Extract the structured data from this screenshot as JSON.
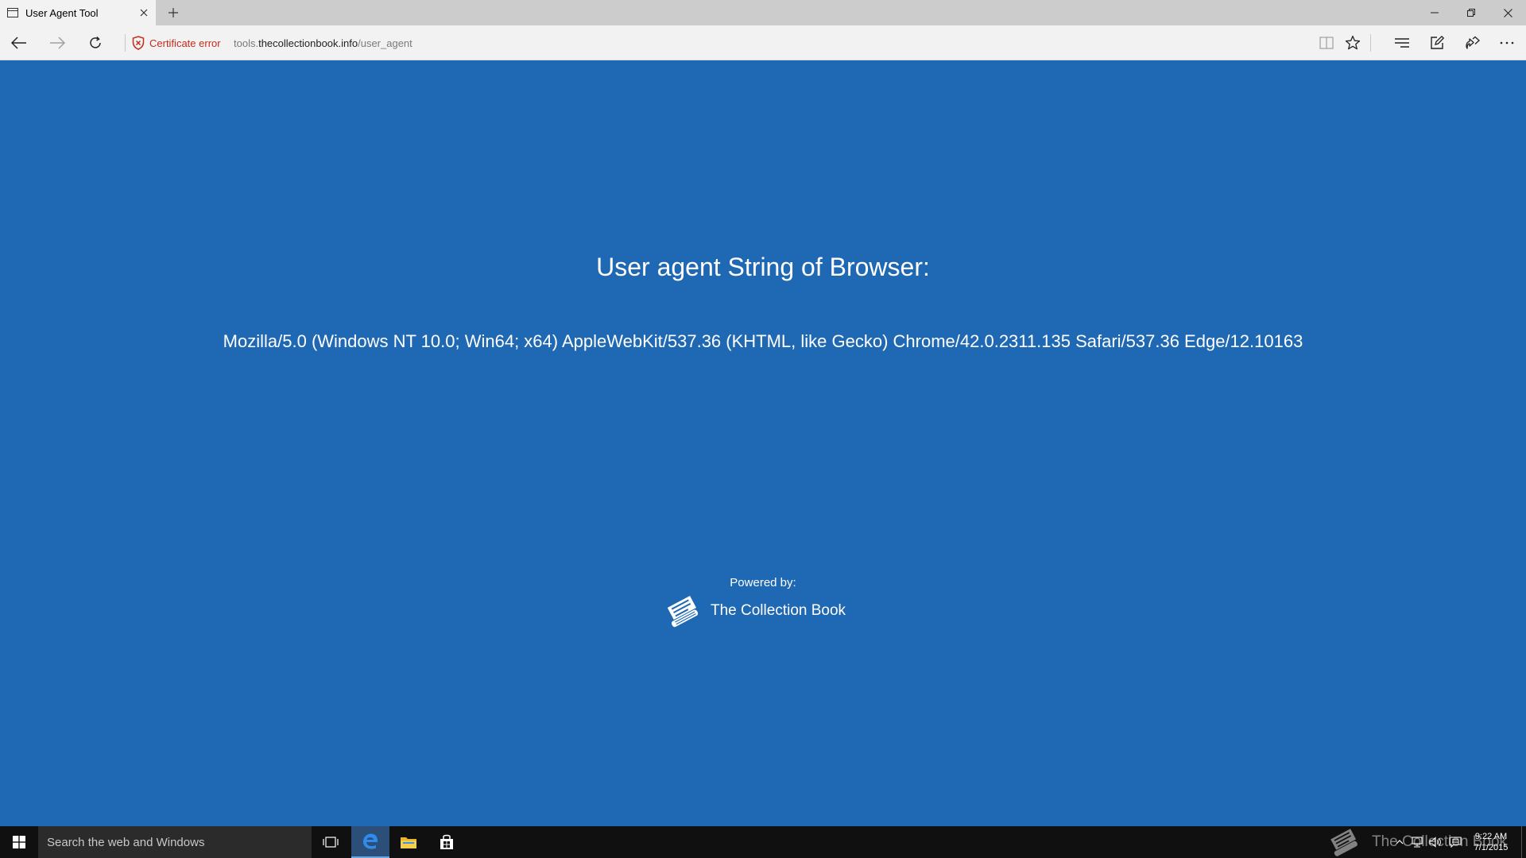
{
  "tab": {
    "title": "User Agent Tool"
  },
  "address_bar": {
    "security_label": "Certificate error",
    "url_prefix": "tools.",
    "url_host": "thecollectionbook.info",
    "url_path": "/user_agent"
  },
  "page": {
    "heading": "User agent String of Browser:",
    "user_agent": "Mozilla/5.0 (Windows NT 10.0; Win64; x64) AppleWebKit/537.36 (KHTML, like Gecko) Chrome/42.0.2311.135 Safari/537.36 Edge/12.10163",
    "powered_by_label": "Powered by:",
    "brand_name": "The Collection Book"
  },
  "taskbar": {
    "search_placeholder": "Search the web and Windows",
    "watermark_text": "The Collection Book",
    "time": "9:22 AM",
    "date": "7/1/2015"
  },
  "colors": {
    "page_background": "#1f68b4",
    "certificate_error": "#c42b1c",
    "taskbar": "#101010"
  },
  "icons": [
    "page-icon",
    "close-icon",
    "plus-icon",
    "minimize-icon",
    "restore-icon",
    "back-icon",
    "forward-icon",
    "refresh-icon",
    "shield-icon",
    "reading-view-icon",
    "star-icon",
    "hub-icon",
    "web-note-icon",
    "share-icon",
    "more-icon",
    "book-icon",
    "windows-icon",
    "task-view-icon",
    "edge-icon",
    "folder-icon",
    "store-icon",
    "chevron-up-icon",
    "network-icon",
    "volume-icon",
    "action-center-icon"
  ]
}
